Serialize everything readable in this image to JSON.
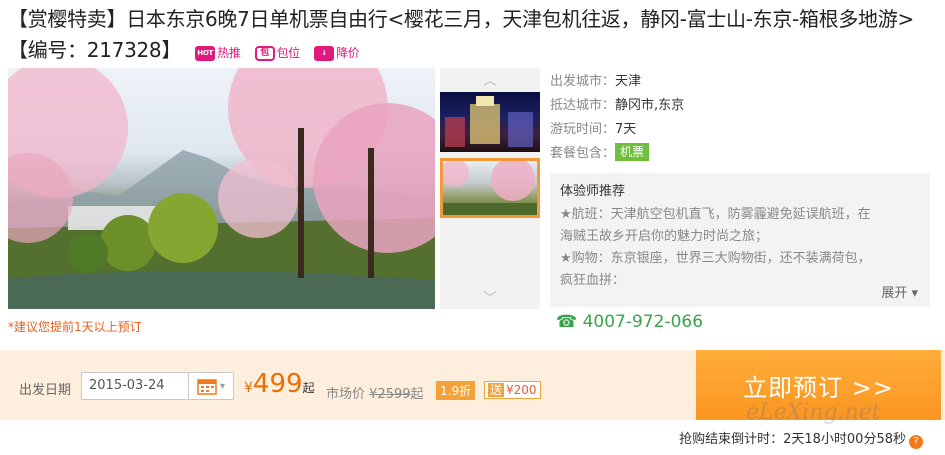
{
  "product": {
    "title": "【赏樱特卖】日本东京6晚7日单机票自由行<樱花三月，天津包机往返，静冈-富士山-东京-箱根多地游>【编号：217328】",
    "badges": [
      {
        "icon": "hot-icon",
        "icon_text": "HOT",
        "label": "热推"
      },
      {
        "icon": "bag-icon",
        "icon_text": "包",
        "label": "包位"
      },
      {
        "icon": "price-down-icon",
        "icon_text": "↓",
        "label": "降价"
      }
    ]
  },
  "info": {
    "depart_city_label": "出发城市：",
    "depart_city": "天津",
    "arrive_city_label": "抵达城市：",
    "arrive_city": "静冈市,东京",
    "duration_label": "游玩时间：",
    "duration": "7天",
    "package_label": "套餐包含：",
    "package_tag": "机票"
  },
  "recommend": {
    "title": "体验师推荐",
    "lines": [
      "★航班：天津航空包机直飞，防雾霾避免延误航班，在",
      "海贼王故乡开启你的魅力时尚之旅；",
      "★购物：东京银座，世界三大购物街，还不装满荷包，",
      "疯狂血拼："
    ],
    "expand_label": "展开"
  },
  "phone": "4007-972-066",
  "booking_hint": "*建议您提前1天以上预订",
  "booking": {
    "date_label": "出发日期",
    "date_value": "2015-03-24",
    "currency": "¥",
    "price": "499",
    "price_suffix": "起",
    "market_label": "市场价",
    "market_price": "¥2599",
    "market_suffix": "起",
    "discount": "1.9折",
    "gift_prefix": "送",
    "gift_value": "¥200",
    "book_button": "立即预订 >>",
    "countdown": "抢购结束倒计时：2天18小时00分58秒",
    "help": "?"
  },
  "watermark": "eLeXing.net",
  "colors": {
    "accent_pink": "#e0197d",
    "price_orange": "#f06d00",
    "book_button": "#fb9520",
    "phone_green": "#3aa34a",
    "tag_green": "#6fbf3a"
  }
}
